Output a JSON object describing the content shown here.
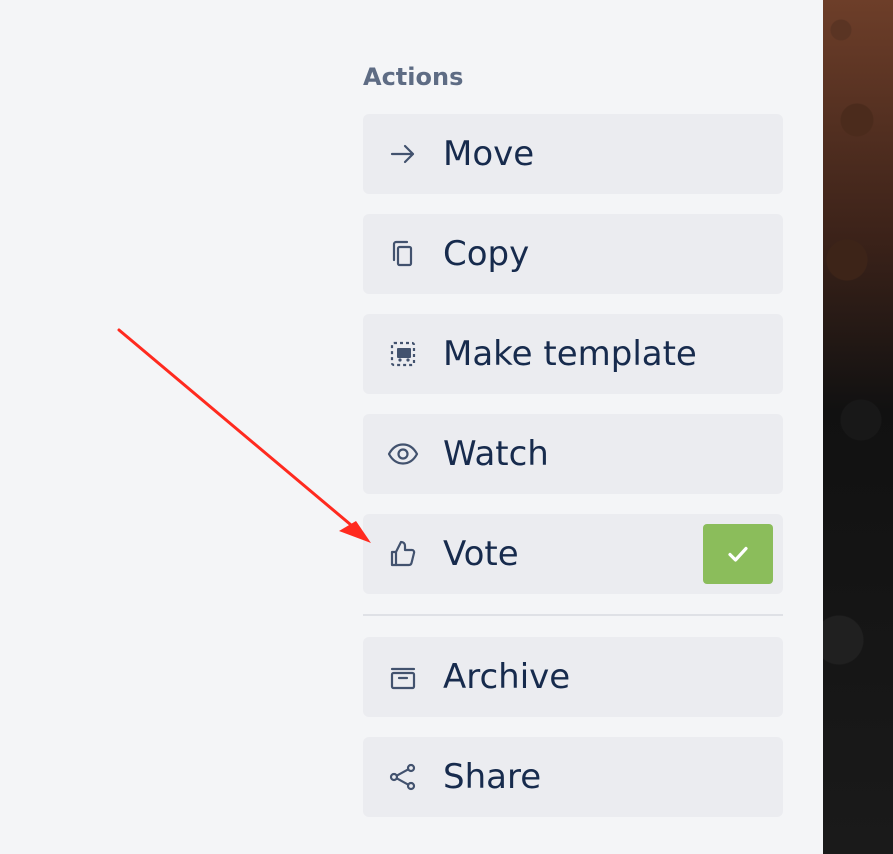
{
  "panel": {
    "title": "Actions",
    "items": [
      {
        "label": "Move",
        "icon": "arrow-right-icon",
        "state": "default"
      },
      {
        "label": "Copy",
        "icon": "copy-icon",
        "state": "default"
      },
      {
        "label": "Make template",
        "icon": "template-icon",
        "state": "default"
      },
      {
        "label": "Watch",
        "icon": "eye-icon",
        "state": "default"
      },
      {
        "label": "Vote",
        "icon": "thumbs-up-icon",
        "state": "checked"
      },
      {
        "label": "Archive",
        "icon": "archive-icon",
        "state": "default"
      },
      {
        "label": "Share",
        "icon": "share-icon",
        "state": "default"
      }
    ]
  },
  "colors": {
    "background": "#f4f5f7",
    "button": "#ebecf0",
    "text": "#172b4d",
    "muted": "#5e6c84",
    "icon": "#42526e",
    "success": "#8bbd5b",
    "annotation": "#ff2a1f"
  }
}
